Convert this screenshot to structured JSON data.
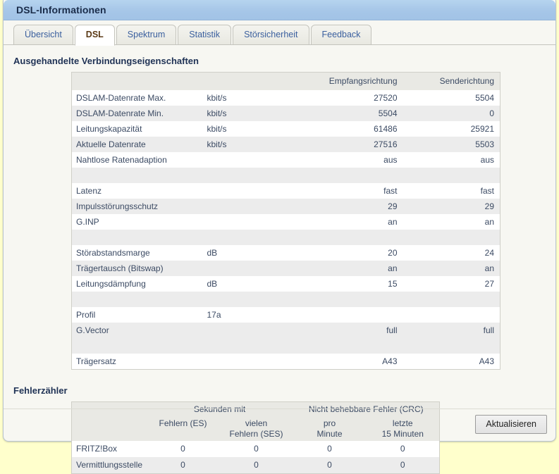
{
  "window": {
    "title": "DSL-Informationen"
  },
  "tabs": [
    {
      "label": "Übersicht",
      "active": false
    },
    {
      "label": "DSL",
      "active": true
    },
    {
      "label": "Spektrum",
      "active": false
    },
    {
      "label": "Statistik",
      "active": false
    },
    {
      "label": "Störsicherheit",
      "active": false
    },
    {
      "label": "Feedback",
      "active": false
    }
  ],
  "negotiated": {
    "section_title": "Ausgehandelte Verbindungseigenschaften",
    "headers": {
      "label": "",
      "unit": "",
      "downstream": "Empfangsrichtung",
      "upstream": "Senderichtung"
    },
    "rows": [
      {
        "type": "data",
        "label": "DSLAM-Datenrate Max.",
        "unit": "kbit/s",
        "down": "27520",
        "up": "5504"
      },
      {
        "type": "data",
        "label": "DSLAM-Datenrate Min.",
        "unit": "kbit/s",
        "down": "5504",
        "up": "0"
      },
      {
        "type": "data",
        "label": "Leitungskapazität",
        "unit": "kbit/s",
        "down": "61486",
        "up": "25921"
      },
      {
        "type": "data",
        "label": "Aktuelle Datenrate",
        "unit": "kbit/s",
        "down": "27516",
        "up": "5503"
      },
      {
        "type": "data",
        "label": "Nahtlose Ratenadaption",
        "unit": "",
        "down": "aus",
        "up": "aus"
      },
      {
        "type": "spacer",
        "label": "",
        "unit": "",
        "down": "",
        "up": ""
      },
      {
        "type": "data",
        "label": "Latenz",
        "unit": "",
        "down": "fast",
        "up": "fast"
      },
      {
        "type": "data",
        "label": "Impulsstörungsschutz",
        "unit": "",
        "down": "29",
        "up": "29"
      },
      {
        "type": "data",
        "label": "G.INP",
        "unit": "",
        "down": "an",
        "up": "an"
      },
      {
        "type": "spacer",
        "label": "",
        "unit": "",
        "down": "",
        "up": ""
      },
      {
        "type": "data",
        "label": "Störabstandsmarge",
        "unit": "dB",
        "down": "20",
        "up": "24"
      },
      {
        "type": "data",
        "label": "Trägertausch (Bitswap)",
        "unit": "",
        "down": "an",
        "up": "an"
      },
      {
        "type": "data",
        "label": "Leitungsdämpfung",
        "unit": "dB",
        "down": "15",
        "up": "27"
      },
      {
        "type": "spacer",
        "label": "",
        "unit": "",
        "down": "",
        "up": ""
      },
      {
        "type": "data",
        "label": "Profil",
        "unit": "17a",
        "down": "",
        "up": ""
      },
      {
        "type": "data",
        "label": "G.Vector",
        "unit": "",
        "down": "full",
        "up": "full"
      },
      {
        "type": "spacer",
        "label": "",
        "unit": "",
        "down": "",
        "up": ""
      },
      {
        "type": "data",
        "label": "Trägersatz",
        "unit": "",
        "down": "A43",
        "up": "A43"
      }
    ]
  },
  "errors": {
    "section_title": "Fehlerzähler",
    "group_headers": {
      "seconds": "Sekunden mit",
      "crc": "Nicht behebbare Fehler (CRC)"
    },
    "column_headers": {
      "es_line1": "Fehlern (ES)",
      "es_line2": "",
      "ses_line1": "vielen",
      "ses_line2": "Fehlern (SES)",
      "per_minute_line1": "pro",
      "per_minute_line2": "Minute",
      "last15_line1": "letzte",
      "last15_line2": "15 Minuten"
    },
    "rows": [
      {
        "label": "FRITZ!Box",
        "es": "0",
        "ses": "0",
        "per_minute": "0",
        "last15": "0"
      },
      {
        "label": "Vermittlungsstelle",
        "es": "0",
        "ses": "0",
        "per_minute": "0",
        "last15": "0"
      }
    ]
  },
  "footer": {
    "update_label": "Aktualisieren"
  },
  "colors": {
    "titlebar": "#a6c6e8",
    "page_background": "#ffffcc",
    "panel": "#f7f7f2",
    "table_header": "#e9e9e4",
    "row_alt": "#ececec",
    "heading_text": "#1f3255",
    "tab_text": "#3a5f9e",
    "active_tab_text": "#5b3a16"
  }
}
